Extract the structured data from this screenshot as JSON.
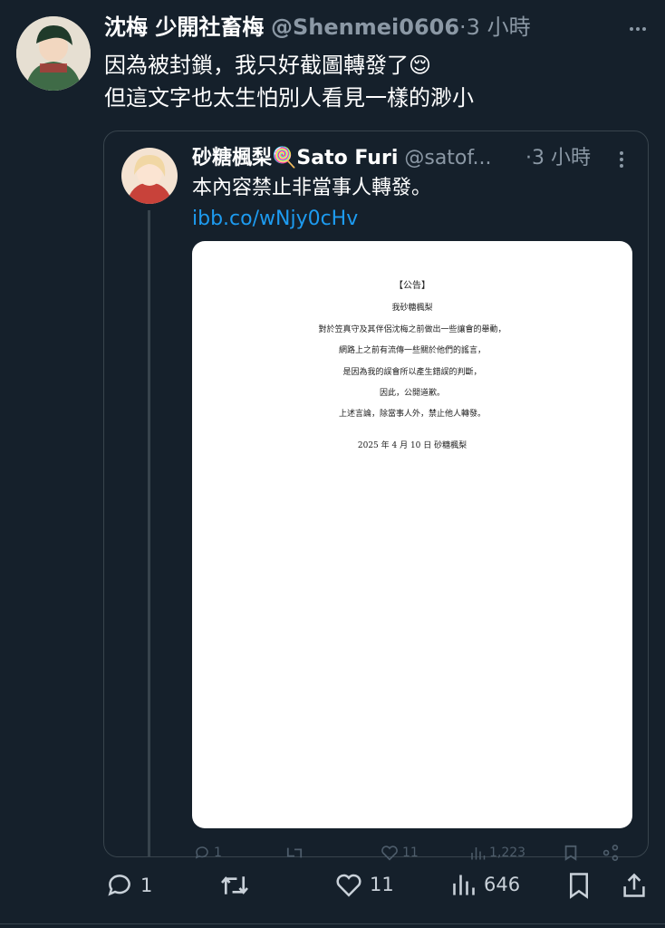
{
  "tweet": {
    "display_name": "沈梅 少開社畜梅",
    "handle": "@Shenmei0606",
    "time": "·3 小時",
    "text_line1": "因為被封鎖，我只好截圖轉發了😌",
    "text_line2": "但這文字也太生怕別人看見一樣的渺小"
  },
  "quote": {
    "display_name": "砂糖楓梨🍭Sato Furi",
    "handle": "@satof...",
    "time": "·3 小時",
    "text": "本內容禁止非當事人轉發。",
    "link": "ibb.co/wNjy0cHv",
    "ghost_stats": {
      "replies": "1",
      "likes": "11",
      "views": "1,223"
    }
  },
  "document": {
    "title": "【公告】",
    "lines": [
      "我砂糖楓梨",
      "對於笠真守及其伴侶沈梅之前做出一些讓會的舉動，",
      "網路上之前有流傳一些關於他們的謠言，",
      "是因為我的誤會所以產生錯誤的判斷，",
      "因此，公開道歉。",
      "上述言論，除當事人外，禁止他人轉發。"
    ],
    "date": "2025 年 4 月 10 日 砂糖楓梨"
  },
  "actions": {
    "replies": "1",
    "likes": "11",
    "views": "646"
  },
  "colors": {
    "background": "#15202b",
    "accent_link": "#1d9bf0",
    "border": "#38444d"
  }
}
